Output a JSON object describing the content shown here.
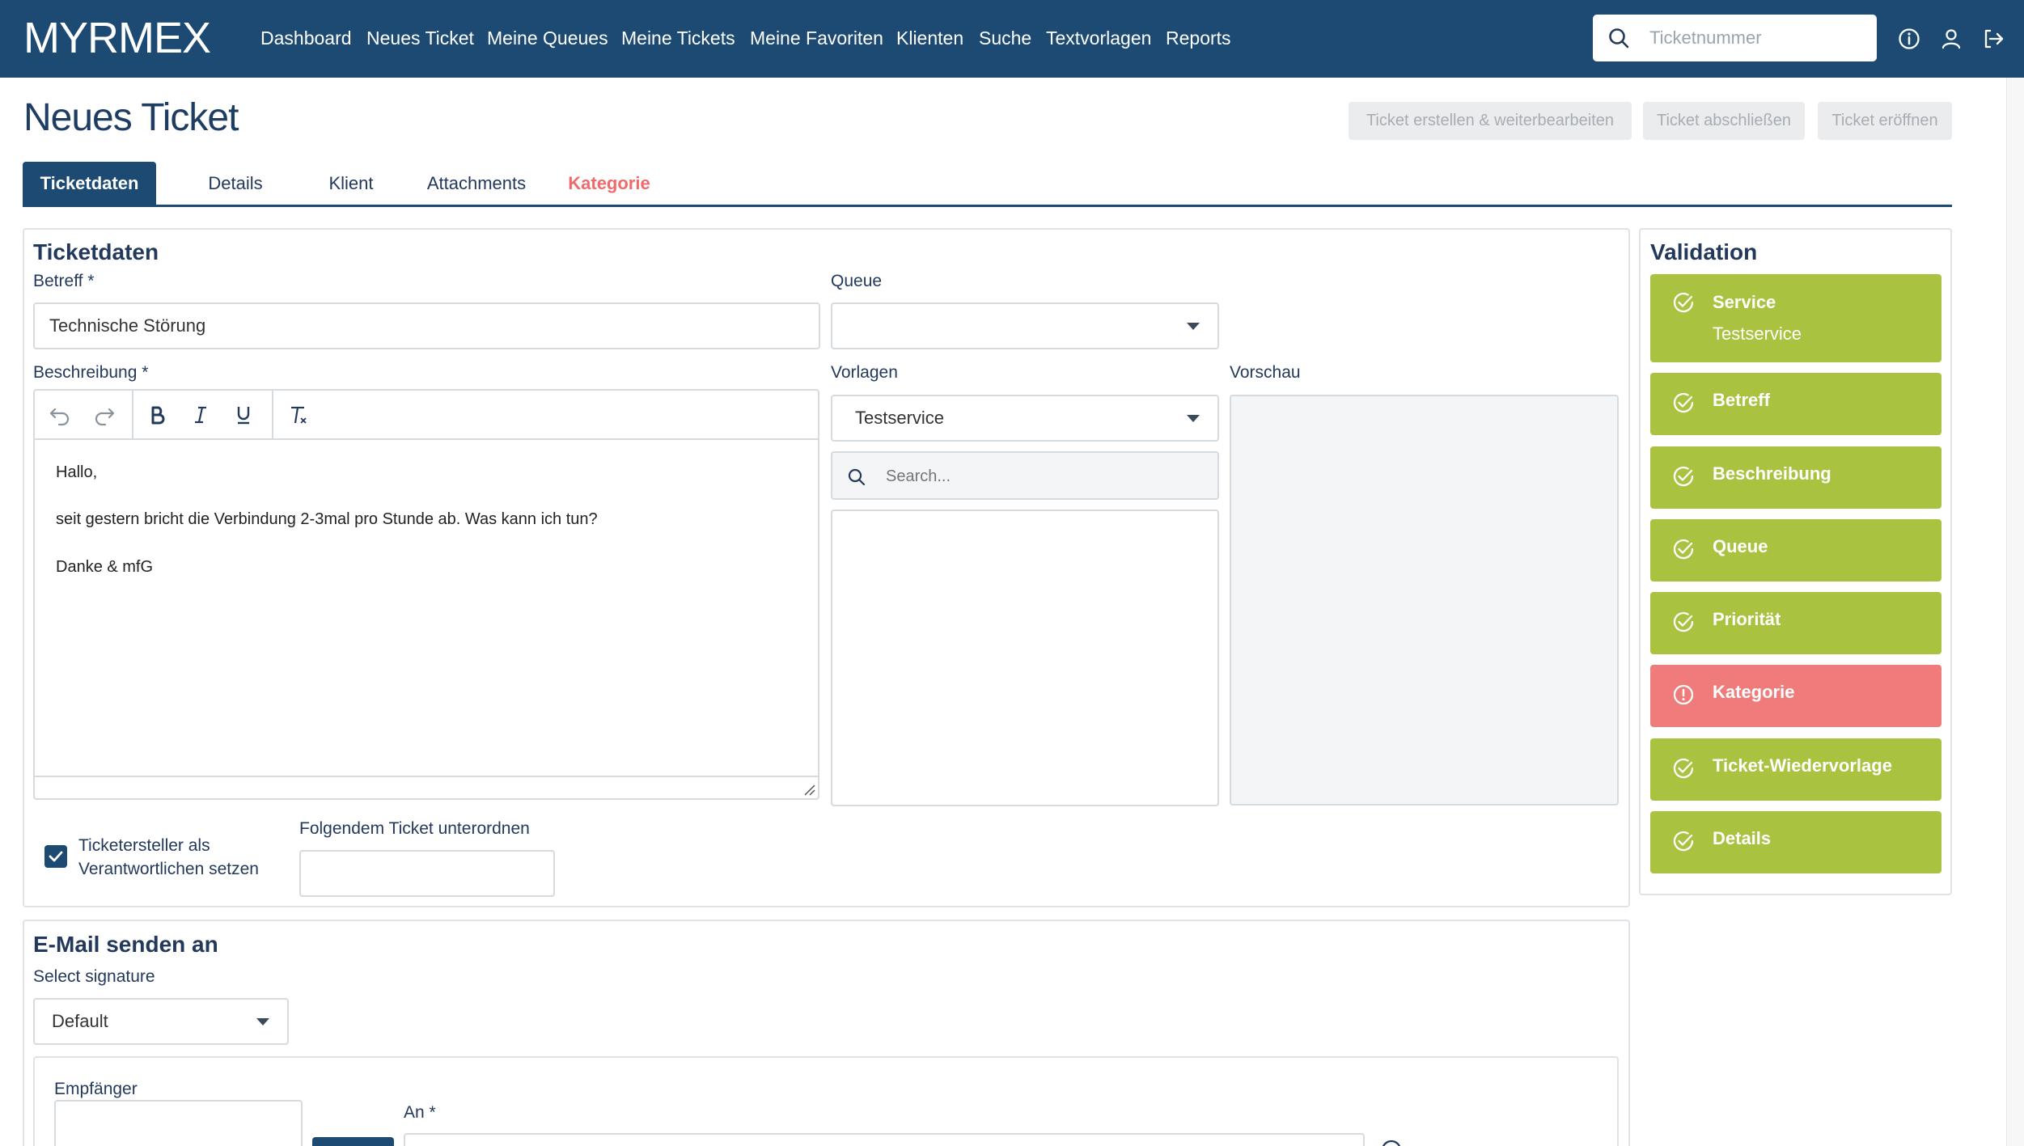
{
  "app": {
    "logo": "MYRMEX"
  },
  "nav": {
    "links": [
      "Dashboard",
      "Neues Ticket",
      "Meine Queues",
      "Meine Tickets",
      "Meine Favoriten",
      "Klienten",
      "Suche",
      "Textvorlagen",
      "Reports"
    ],
    "search_placeholder": "Ticketnummer",
    "icons": [
      "info-icon",
      "user-icon",
      "logout-icon"
    ]
  },
  "page": {
    "title": "Neues Ticket",
    "actions": [
      "Ticket erstellen & weiterbearbeiten",
      "Ticket abschließen",
      "Ticket eröffnen"
    ]
  },
  "tabs": [
    {
      "label": "Ticketdaten",
      "state": "active"
    },
    {
      "label": "Details",
      "state": "normal"
    },
    {
      "label": "Klient",
      "state": "normal"
    },
    {
      "label": "Attachments",
      "state": "normal"
    },
    {
      "label": "Kategorie",
      "state": "error"
    }
  ],
  "ticketdaten": {
    "title": "Ticketdaten",
    "betreff_label": "Betreff *",
    "betreff_value": "Technische Störung",
    "queue_label": "Queue",
    "queue_value": "",
    "beschreibung_label": "Beschreibung *",
    "editor_lines": [
      "Hallo,",
      "seit gestern bricht die Verbindung 2-3mal pro Stunde ab. Was kann ich tun?",
      "Danke & mfG"
    ],
    "vorlagen_label": "Vorlagen",
    "vorlagen_value": "Testservice",
    "vorlagen_search_placeholder": "Search...",
    "vorschau_label": "Vorschau",
    "checkbox_label_line1": "Ticketersteller als",
    "checkbox_label_line2": "Verantwortlichen setzen",
    "checkbox_checked": true,
    "unterordnen_label": "Folgendem Ticket unterordnen",
    "unterordnen_value": ""
  },
  "email": {
    "title": "E-Mail senden an",
    "signature_label": "Select signature",
    "signature_value": "Default",
    "empfaenger_label": "Empfänger",
    "an_label": "An *"
  },
  "validation": {
    "title": "Validation",
    "items": [
      {
        "label": "Service",
        "sub": "Testservice",
        "status": "ok"
      },
      {
        "label": "Betreff",
        "status": "ok"
      },
      {
        "label": "Beschreibung",
        "status": "ok"
      },
      {
        "label": "Queue",
        "status": "ok"
      },
      {
        "label": "Priorität",
        "status": "ok"
      },
      {
        "label": "Kategorie",
        "status": "error"
      },
      {
        "label": "Ticket-Wiedervorlage",
        "status": "ok"
      },
      {
        "label": "Details",
        "status": "ok"
      }
    ]
  },
  "colors": {
    "navbar": "#1c4a72",
    "ok": "#a9c23f",
    "error": "#f07b7b",
    "error_text": "#ef6b6b"
  }
}
